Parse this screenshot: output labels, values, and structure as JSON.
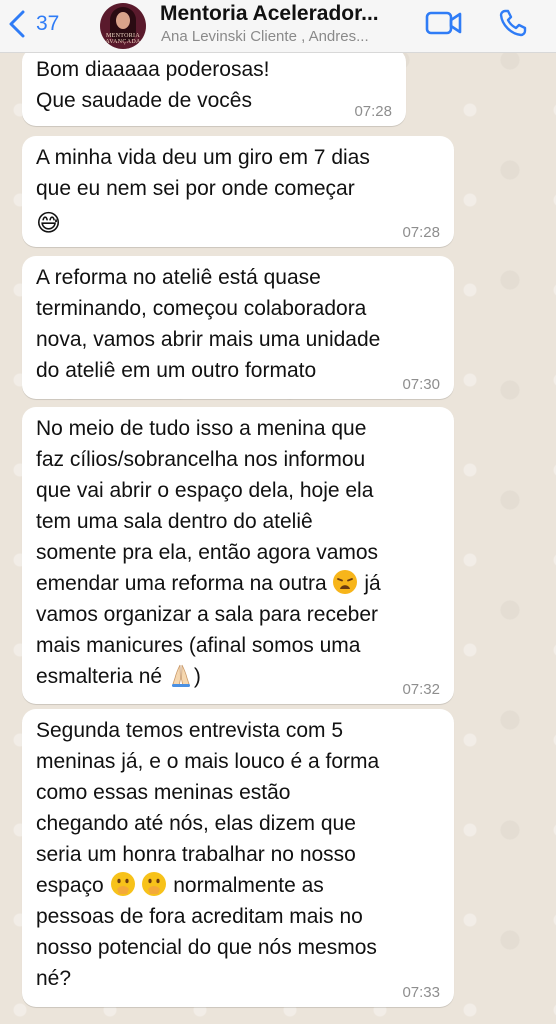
{
  "header": {
    "back_count": "37",
    "title": "Mentoria Acelerador...",
    "subtitle": "Ana Levinski Cliente , Andres...",
    "avatar_text": "MENTORIA AVANÇADA"
  },
  "messages": [
    {
      "text": "Bom diaaaaa poderosas!\nQue saudade de vocês",
      "time": "07:28"
    },
    {
      "text": "A minha vida deu um giro em 7 dias\nque eu nem sei por onde começar\n",
      "emoji": "😅",
      "time": "07:28"
    },
    {
      "text": "A reforma no ateliê está quase\nterminando, começou colaboradora\nnova, vamos abrir mais uma unidade\ndo ateliê em um outro formato",
      "time": "07:30"
    },
    {
      "text_a": "No meio de tudo isso a menina que\nfaz cílios/sobrancelha nos informou\nque vai abrir o espaço dela, hoje ela\ntem uma sala dentro do ateliê\nsomente pra ela, então agora vamos\nemendar uma reforma na outra ",
      "text_b": " já\nvamos organizar a sala para receber\nmais manicures (afinal somos uma\nesmalteria né ",
      "text_c": ")",
      "time": "07:32"
    },
    {
      "text_a": "Segunda temos entrevista com 5\nmeninas já, e o mais louco é a forma\ncomo essas meninas estão\nchegando até nós, elas dizem que\nseria um honra trabalhar no nosso\nespaço ",
      "text_b": " normalmente as\npessoas de fora acreditam mais no\nnosso potencial do que nós mesmos\nné?",
      "time": "07:33"
    }
  ],
  "icons": {
    "back": "chevron-left-icon",
    "video": "video-call-icon",
    "phone": "phone-call-icon"
  },
  "colors": {
    "accent": "#2f7cf6",
    "bubble": "#ffffff",
    "wallpaper": "#ece5dd"
  }
}
